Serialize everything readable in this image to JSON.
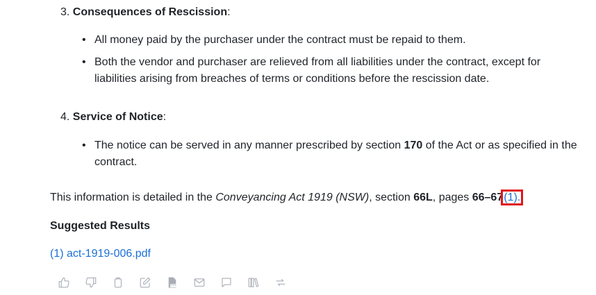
{
  "sections": [
    {
      "number": "3.",
      "title": "Consequences of Rescission",
      "colon": ":",
      "bullets": [
        "All money paid by the purchaser under the contract must be repaid to them.",
        "Both the vendor and purchaser are relieved from all liabilities under the contract, except for liabilities arising from breaches of terms or conditions before the rescission date."
      ]
    },
    {
      "number": "4.",
      "title": "Service of Notice",
      "colon": ":",
      "bullet_parts": {
        "before": "The notice can be served in any manner prescribed by section ",
        "bold": "170",
        "after": " of the Act or as specified in the contract."
      }
    }
  ],
  "summary": {
    "prefix": "This information is detailed in the ",
    "act": "Conveyancing Act 1919 (NSW)",
    "middle": ", section ",
    "section": "66L",
    "pages_label": ", pages ",
    "pages": "66–67",
    "citation": "(1).",
    "bullet_char": "•"
  },
  "suggested": {
    "title": "Suggested Results",
    "link": "(1) act-1919-006.pdf"
  },
  "toolbar": {
    "icons": [
      "thumbs-up-icon",
      "thumbs-down-icon",
      "copy-icon",
      "edit-icon",
      "doc-export-icon",
      "email-icon",
      "comment-icon",
      "library-icon",
      "refresh-icon"
    ]
  },
  "colors": {
    "link": "#1a6fd8",
    "highlight": "#e0161c",
    "icon": "#a9aeb5"
  }
}
